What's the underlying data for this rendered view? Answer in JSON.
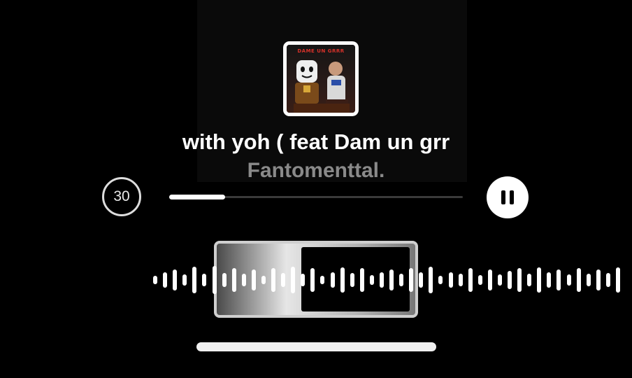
{
  "track": {
    "title": "with yoh ( feat Dam un grr",
    "artist": "Fantomenttal.",
    "cover_text": "DAME UN GRRR"
  },
  "controls": {
    "skip_label": "30",
    "progress": 0.19
  },
  "waveform": {
    "bar_levels": [
      0.3,
      0.55,
      0.75,
      0.4,
      0.95,
      0.45,
      1.0,
      0.5,
      0.85,
      0.45,
      0.75,
      0.3,
      0.85,
      0.5,
      0.95,
      0.45,
      0.85,
      0.3,
      0.55,
      0.9,
      0.5,
      0.85,
      0.35,
      0.55,
      0.75,
      0.45,
      0.85,
      0.55,
      0.95,
      0.3,
      0.55,
      0.45,
      0.85,
      0.35,
      0.75,
      0.4,
      0.65,
      0.85,
      0.45,
      0.9,
      0.55,
      0.75,
      0.4,
      0.85,
      0.45,
      0.75,
      0.5,
      0.9
    ],
    "selection": {
      "start_fraction": 0.34,
      "end_fraction": 0.66
    }
  },
  "colors": {
    "background": "#000000",
    "artist_text": "#8a8a8a",
    "accent": "#ffffff"
  }
}
